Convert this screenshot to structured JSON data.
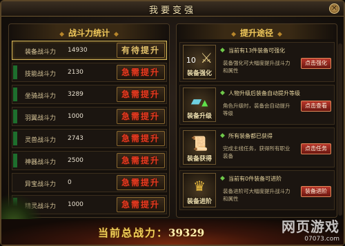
{
  "window": {
    "title": "我要变强"
  },
  "stats_panel": {
    "header": "战斗力统计",
    "rows": [
      {
        "label": "装备战斗力",
        "value": "14930",
        "button": "有待提升",
        "status": "room"
      },
      {
        "label": "技能战斗力",
        "value": "2130",
        "button": "急需提升",
        "status": "urgent"
      },
      {
        "label": "坐骑战斗力",
        "value": "3289",
        "button": "急需提升",
        "status": "urgent"
      },
      {
        "label": "羽翼战斗力",
        "value": "1000",
        "button": "急需提升",
        "status": "urgent"
      },
      {
        "label": "灵兽战斗力",
        "value": "2743",
        "button": "急需提升",
        "status": "urgent"
      },
      {
        "label": "神器战斗力",
        "value": "2500",
        "button": "急需提升",
        "status": "urgent"
      },
      {
        "label": "异宝战斗力",
        "value": "0",
        "button": "急需提升",
        "status": "urgent"
      },
      {
        "label": "精灵战斗力",
        "value": "1000",
        "button": "急需提升",
        "status": "urgent"
      }
    ]
  },
  "path_panel": {
    "header": "提升途径",
    "items": [
      {
        "icon_label": "装备强化",
        "icon_badge": "10",
        "title": "当前有13件装备可强化",
        "desc": "装备强化可大幅度提升战斗力和属性",
        "button": "点击强化"
      },
      {
        "icon_label": "装备升级",
        "title": "人物升级后装备自动提升等级",
        "desc": "角色升级时，装备会自动提升等级",
        "button": "点击查看"
      },
      {
        "icon_label": "装备获得",
        "title": "所有装备都已获得",
        "desc": "完成主线任务，获得所有职业装备",
        "button": "点击任务"
      },
      {
        "icon_label": "装备进阶",
        "title": "当前有0件装备可进阶",
        "desc": "装备进阶可大幅度提升战斗力和属性",
        "button": "装备进阶"
      }
    ]
  },
  "footer": {
    "total_label": "当前总战力：",
    "total_value": "39329"
  },
  "watermark": {
    "big": "网页游戏",
    "small": "07073.com"
  },
  "colors": {
    "urgent": "#e83b21",
    "room": "#e1c06a",
    "accent": "#f0c85a"
  }
}
